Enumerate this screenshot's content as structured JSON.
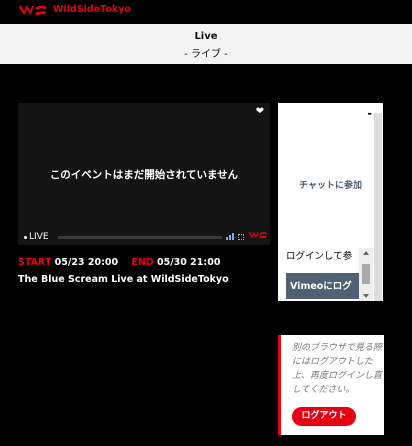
{
  "header": {
    "brand": "WildSideTokyo",
    "brand_color": "#e60012"
  },
  "titlebar": {
    "title": "Live",
    "subtitle": "- ライブ -"
  },
  "player": {
    "message": "このイベントはまだ開始されていません",
    "live_label": "LIVE",
    "icons": [
      "heart-icon",
      "volume-icon",
      "fullscreen-icon"
    ]
  },
  "event": {
    "start_label": "START",
    "start_value": "05/23 20:00",
    "end_label": "END",
    "end_value": "05/30 21:00",
    "title": "The Blue Scream Live at WildSideTokyo"
  },
  "chat": {
    "minimize": "-",
    "join": "チャットに参加",
    "login_prompt": "ログインして参",
    "vimeo_login": "Vimeoにログ"
  },
  "notice": {
    "text": "別のブラウザで見る際にはログアウトした上、再度ログインし直してください。",
    "logout": "ログアウト"
  }
}
